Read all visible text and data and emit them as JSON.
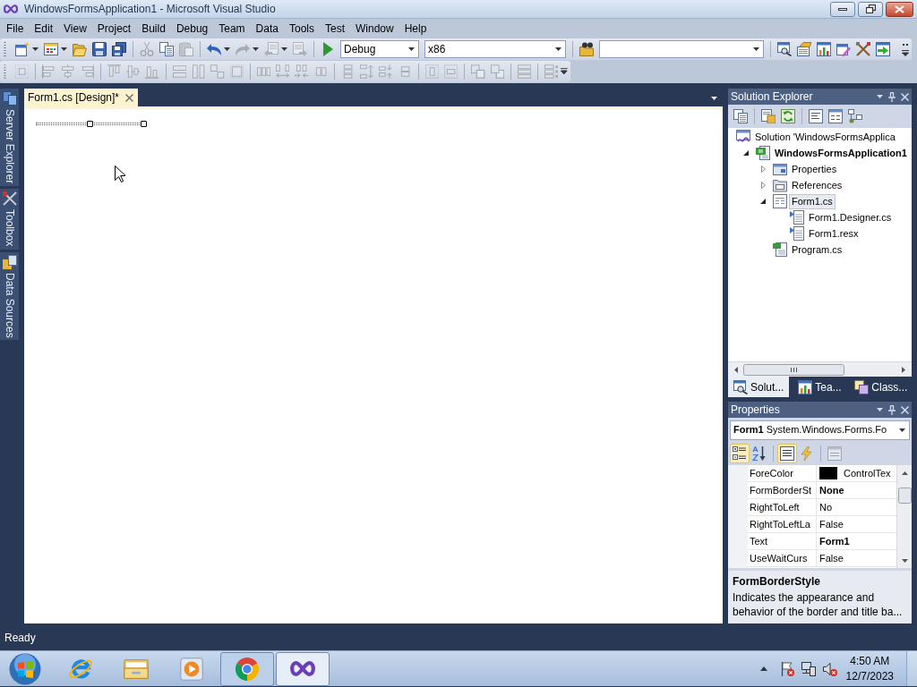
{
  "window": {
    "title": "WindowsFormsApplication1 - Microsoft Visual Studio"
  },
  "menu": [
    "File",
    "Edit",
    "View",
    "Project",
    "Build",
    "Debug",
    "Team",
    "Data",
    "Tools",
    "Test",
    "Window",
    "Help"
  ],
  "standard_toolbar": [
    [
      {
        "kind": "new",
        "disabled": false,
        "dropdown": true
      },
      {
        "kind": "add",
        "disabled": false,
        "dropdown": true
      },
      {
        "kind": "open",
        "disabled": false,
        "dropdown": false
      },
      {
        "kind": "save",
        "disabled": false,
        "dropdown": false
      },
      {
        "kind": "saveall",
        "disabled": false,
        "dropdown": false
      }
    ],
    [
      {
        "kind": "cut",
        "disabled": true,
        "dropdown": false
      },
      {
        "kind": "copy",
        "disabled": false,
        "dropdown": false
      },
      {
        "kind": "paste",
        "disabled": true,
        "dropdown": false
      }
    ],
    [
      {
        "kind": "undo",
        "disabled": false,
        "dropdown": true
      },
      {
        "kind": "redo",
        "disabled": true,
        "dropdown": true
      },
      {
        "kind": "back",
        "disabled": true,
        "dropdown": true
      },
      {
        "kind": "forward",
        "disabled": true,
        "dropdown": false
      }
    ],
    [
      {
        "kind": "start",
        "disabled": false,
        "dropdown": false
      },
      {
        "kind": "combo",
        "value": "Debug"
      },
      {
        "kind": "combo",
        "value": "x86"
      }
    ],
    [
      {
        "kind": "findfiles",
        "disabled": false,
        "dropdown": false
      },
      {
        "kind": "combo"
      }
    ],
    [
      {
        "kind": "solution",
        "disabled": false,
        "dropdown": false
      },
      {
        "kind": "properties",
        "disabled": false,
        "dropdown": false
      },
      {
        "kind": "browser",
        "disabled": false,
        "dropdown": false
      },
      {
        "kind": "toolbox",
        "disabled": false,
        "dropdown": false
      },
      {
        "kind": "extensions",
        "disabled": false,
        "dropdown": false
      },
      {
        "kind": "startpage",
        "disabled": false,
        "dropdown": false
      }
    ]
  ],
  "layout_toolbar": [
    [
      {
        "kind": "aligngrid",
        "disabled": true,
        "dropdown": false
      }
    ],
    [
      {
        "kind": "alignleft",
        "disabled": true,
        "dropdown": false
      },
      {
        "kind": "aligncenter",
        "disabled": true,
        "dropdown": false
      },
      {
        "kind": "alignright",
        "disabled": true,
        "dropdown": false
      }
    ],
    [
      {
        "kind": "aligntop",
        "disabled": true,
        "dropdown": false
      },
      {
        "kind": "alignmiddle",
        "disabled": true,
        "dropdown": false
      },
      {
        "kind": "alignbottom",
        "disabled": true,
        "dropdown": false
      }
    ],
    [
      {
        "kind": "samewidth",
        "disabled": true,
        "dropdown": false
      },
      {
        "kind": "sameheight",
        "disabled": true,
        "dropdown": false
      },
      {
        "kind": "samesize",
        "disabled": true,
        "dropdown": false
      },
      {
        "kind": "sizegrid",
        "disabled": true,
        "dropdown": false
      }
    ],
    [
      {
        "kind": "hequal",
        "disabled": true,
        "dropdown": false
      },
      {
        "kind": "hinc",
        "disabled": true,
        "dropdown": false
      },
      {
        "kind": "hdec",
        "disabled": true,
        "dropdown": false
      },
      {
        "kind": "hremove",
        "disabled": true,
        "dropdown": false
      }
    ],
    [
      {
        "kind": "vequal",
        "disabled": true,
        "dropdown": false
      },
      {
        "kind": "vinc",
        "disabled": true,
        "dropdown": false
      },
      {
        "kind": "vdec",
        "disabled": true,
        "dropdown": false
      },
      {
        "kind": "vremove",
        "disabled": true,
        "dropdown": false
      }
    ],
    [
      {
        "kind": "centerh",
        "disabled": true,
        "dropdown": false
      },
      {
        "kind": "centerv",
        "disabled": true,
        "dropdown": false
      }
    ],
    [
      {
        "kind": "front",
        "disabled": true,
        "dropdown": false
      },
      {
        "kind": "toback",
        "disabled": true,
        "dropdown": false
      }
    ],
    [
      {
        "kind": "bars",
        "disabled": true,
        "dropdown": false
      }
    ],
    [
      {
        "kind": "taborder",
        "disabled": true,
        "dropdown": false
      }
    ]
  ],
  "side_tabs": [
    {
      "kind": "server",
      "label": "Server Explorer"
    },
    {
      "kind": "toolbox",
      "label": "Toolbox"
    },
    {
      "kind": "data",
      "label": "Data Sources"
    }
  ],
  "document_tabs": [
    {
      "label": "Form1.cs [Design]*",
      "selected": true
    }
  ],
  "designer": {
    "form_selected": true
  },
  "solution_explorer": {
    "title": "Solution Explorer",
    "tree": [
      {
        "label": "Solution 'WindowsFormsApplica",
        "kind": "solution",
        "bold": false,
        "selected": false,
        "children": [
          {
            "label": "WindowsFormsApplication1",
            "kind": "project",
            "bold": true,
            "selected": false,
            "expanded": true,
            "children": [
              {
                "label": "Properties",
                "kind": "properties",
                "bold": false,
                "selected": false,
                "expanded": false
              },
              {
                "label": "References",
                "kind": "references",
                "bold": false,
                "selected": false,
                "expanded": false
              },
              {
                "label": "Form1.cs",
                "kind": "form",
                "bold": false,
                "selected": true,
                "expanded": true,
                "children": [
                  {
                    "label": "Form1.Designer.cs",
                    "kind": "dependent",
                    "bold": false,
                    "selected": false
                  },
                  {
                    "label": "Form1.resx",
                    "kind": "dependent",
                    "bold": false,
                    "selected": false
                  }
                ]
              },
              {
                "label": "Program.cs",
                "kind": "code",
                "bold": false,
                "selected": false
              }
            ]
          }
        ]
      }
    ],
    "tabs": [
      {
        "kind": "solution",
        "label": "Solut...",
        "selected": true
      },
      {
        "kind": "team",
        "label": "Tea...",
        "selected": false
      },
      {
        "kind": "class",
        "label": "Class...",
        "selected": false
      }
    ]
  },
  "properties": {
    "title": "Properties",
    "object": "**Form1** System.Windows.Forms.Fo",
    "toolbar": [
      [
        {
          "kind": "categorized",
          "selected": true,
          "disabled": false
        },
        {
          "kind": "alphabetical",
          "selected": false,
          "disabled": false
        }
      ],
      [
        {
          "kind": "properties",
          "selected": true,
          "disabled": false
        },
        {
          "kind": "events",
          "selected": false,
          "disabled": false
        }
      ],
      [
        {
          "kind": "pages",
          "selected": false,
          "disabled": true
        }
      ]
    ],
    "rows": [
      {
        "kind": "color",
        "name": "ForeColor",
        "value": "ControlTex",
        "color": "#000000",
        "bold": false
      },
      {
        "kind": "text",
        "name": "FormBorderSt",
        "value": "None",
        "bold": true
      },
      {
        "kind": "text",
        "name": "RightToLeft",
        "value": "No",
        "bold": false
      },
      {
        "kind": "text",
        "name": "RightToLeftLa",
        "value": "False",
        "bold": false
      },
      {
        "kind": "text",
        "name": "Text",
        "value": "Form1",
        "bold": true
      },
      {
        "kind": "text",
        "name": "UseWaitCurs",
        "value": "False",
        "bold": false
      }
    ],
    "description": {
      "title": "FormBorderStyle",
      "text": "Indicates the appearance and behavior of the border and title ba..."
    }
  },
  "status_bar": {
    "text": "Ready"
  },
  "taskbar": {
    "apps": [
      {
        "kind": "ie",
        "running": false,
        "selected": false
      },
      {
        "kind": "folder",
        "running": false,
        "selected": false
      },
      {
        "kind": "media",
        "running": false,
        "selected": false
      },
      {
        "kind": "chrome",
        "running": true,
        "selected": false
      },
      {
        "kind": "studio",
        "running": true,
        "selected": true
      }
    ],
    "tray": [
      {
        "kind": "flag",
        "alert": true
      },
      {
        "kind": "network",
        "alert": false
      },
      {
        "kind": "volume",
        "alert": true
      }
    ],
    "time": "4:50 AM",
    "date": "12/7/2023"
  }
}
